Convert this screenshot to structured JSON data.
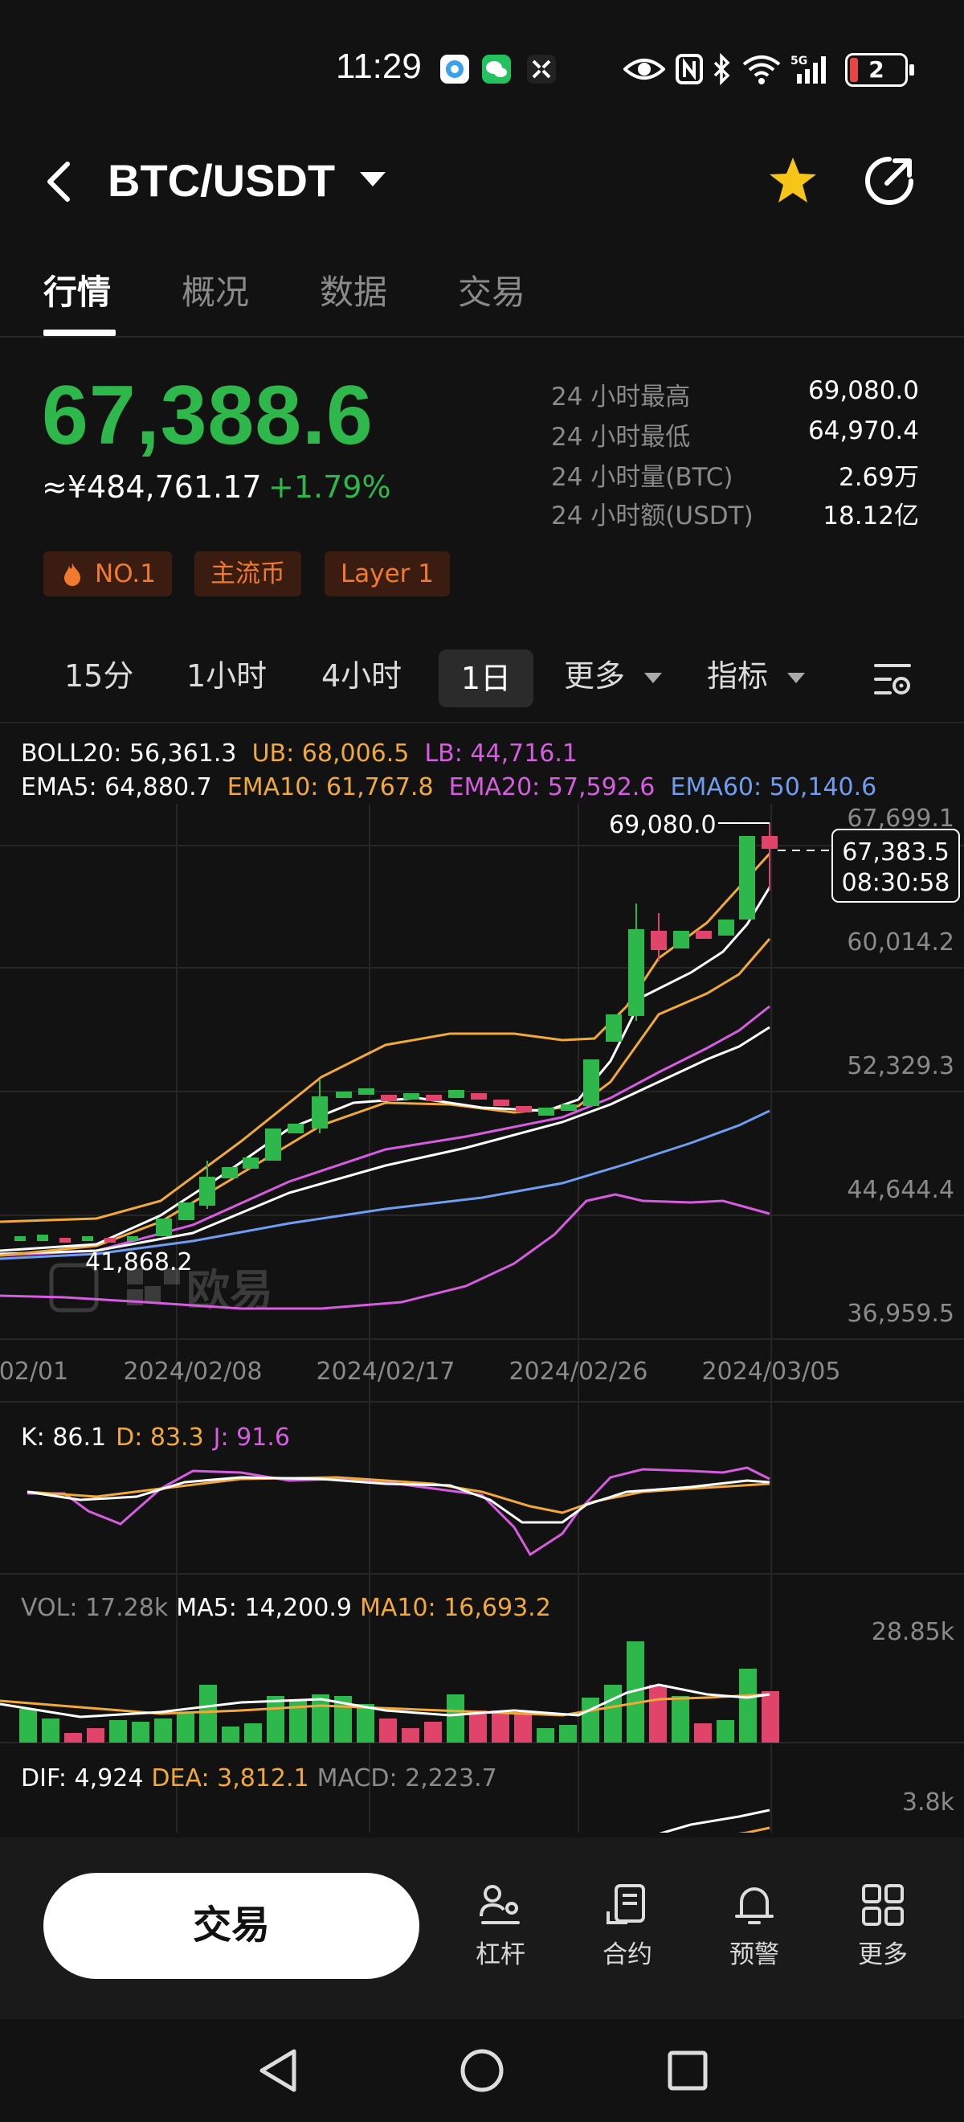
{
  "status_bar": {
    "time": "11:29",
    "battery": "2",
    "network": "5G"
  },
  "header": {
    "title": "BTC/USDT",
    "icons": [
      "back-icon",
      "star-icon",
      "share-icon"
    ]
  },
  "tabs": [
    {
      "label": "行情",
      "active": true
    },
    {
      "label": "概况",
      "active": false
    },
    {
      "label": "数据",
      "active": false
    },
    {
      "label": "交易",
      "active": false
    }
  ],
  "price": {
    "last": "67,388.6",
    "cny": "≈¥484,761.17",
    "change": "+1.79%"
  },
  "stats": [
    {
      "label": "24 小时最高",
      "value": "69,080.0"
    },
    {
      "label": "24 小时最低",
      "value": "64,970.4"
    },
    {
      "label": "24 小时量(BTC)",
      "value": "2.69万"
    },
    {
      "label": "24 小时额(USDT)",
      "value": "18.12亿"
    }
  ],
  "tags": [
    "NO.1",
    "主流币",
    "Layer 1"
  ],
  "timeframes": {
    "items": [
      "15分",
      "1小时",
      "4小时",
      "1日"
    ],
    "selected": "1日",
    "more": "更多",
    "indicators": "指标"
  },
  "indicators": {
    "boll": {
      "label": "BOLL20: 56,361.3",
      "ub": "UB: 68,006.5",
      "lb": "LB: 44,716.1"
    },
    "ema": {
      "ema5": "EMA5: 64,880.7",
      "ema10": "EMA10: 61,767.8",
      "ema20": "EMA20: 57,592.6",
      "ema60": "EMA60: 50,140.6"
    },
    "kdj": {
      "k": "K: 86.1",
      "d": "D: 83.3",
      "j": "J: 91.6"
    },
    "vol": {
      "vol": "VOL: 17.28k",
      "ma5": "MA5: 14,200.9",
      "ma10": "MA10: 16,693.2",
      "axis_max": "28.85k"
    },
    "macd": {
      "dif": "DIF: 4,924",
      "dea": "DEA: 3,812.1",
      "macd": "MACD: 2,223.7",
      "axis_max": "3.8k"
    }
  },
  "chart": {
    "y_ticks": [
      "67,699.1",
      "60,014.2",
      "52,329.3",
      "44,644.4",
      "36,959.5"
    ],
    "x_ticks": [
      "02/01",
      "2024/02/08",
      "2024/02/17",
      "2024/02/26",
      "2024/03/05"
    ],
    "high_label": "69,080.0",
    "low_label": "41,868.2",
    "cursor_price": "67,383.5",
    "cursor_time": "08:30:58",
    "watermark": "欧易"
  },
  "chart_data": {
    "type": "candlestick",
    "x": [
      "02/01",
      "2024/02/08",
      "2024/02/17",
      "2024/02/26",
      "2024/03/05"
    ],
    "y_range": [
      36959.5,
      67699.1
    ],
    "high": 69080.0,
    "low": 41868.2,
    "last": 67383.5
  },
  "bottom": {
    "trade_label": "交易",
    "nav": [
      {
        "label": "杠杆",
        "icon": "leverage-icon"
      },
      {
        "label": "合约",
        "icon": "contract-icon"
      },
      {
        "label": "预警",
        "icon": "bell-icon"
      },
      {
        "label": "更多",
        "icon": "grid-icon"
      }
    ]
  },
  "colors": {
    "up": "#2eb84b",
    "down": "#e0446a",
    "bg": "#121212",
    "tag_text": "#f27a2e"
  }
}
